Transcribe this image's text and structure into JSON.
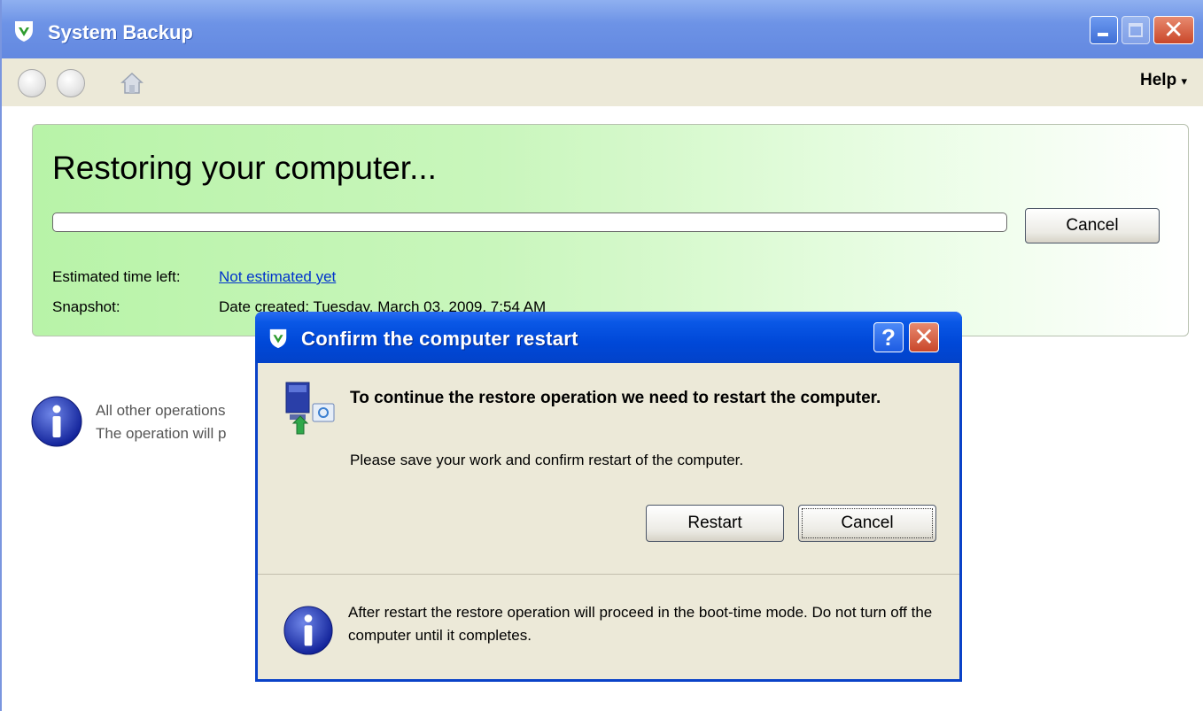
{
  "window": {
    "title": "System Backup",
    "help_menu": "Help"
  },
  "status_panel": {
    "heading": "Restoring your computer...",
    "progress_fraction": 0,
    "cancel_label": "Cancel",
    "estimated_label": "Estimated time left:",
    "estimated_value": "Not estimated yet",
    "snapshot_label": "Snapshot:",
    "snapshot_value": "Date created: Tuesday, March 03, 2009, 7:54 AM"
  },
  "background_info": {
    "line1": "All other operations",
    "line2": "The operation will p"
  },
  "dialog": {
    "title": "Confirm the computer restart",
    "help_glyph": "?",
    "close_glyph": "✕",
    "heading": "To continue the restore operation we need to restart the computer.",
    "message": "Please save your work and confirm restart of the computer.",
    "restart_label": "Restart",
    "cancel_label": "Cancel",
    "footer_text": "After restart the restore operation will proceed in the boot-time mode. Do not turn off the computer until it completes."
  },
  "colors": {
    "titlebar": "#6388e0",
    "dialog_titlebar": "#0048d8",
    "panel_green": "#b8f3a8",
    "link": "#0033cc"
  }
}
